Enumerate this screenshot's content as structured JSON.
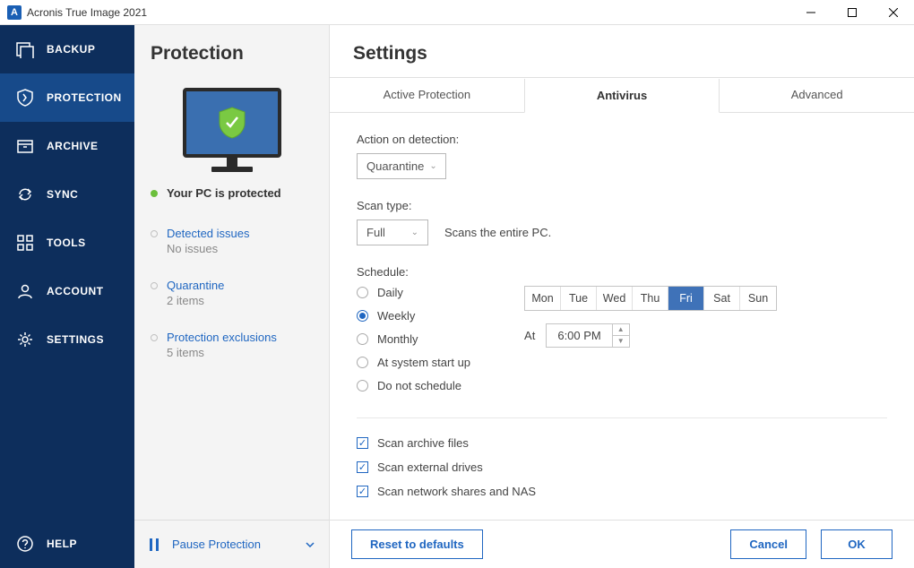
{
  "app_title": "Acronis True Image 2021",
  "sidebar": {
    "items": [
      {
        "label": "BACKUP"
      },
      {
        "label": "PROTECTION"
      },
      {
        "label": "ARCHIVE"
      },
      {
        "label": "SYNC"
      },
      {
        "label": "TOOLS"
      },
      {
        "label": "ACCOUNT"
      },
      {
        "label": "SETTINGS"
      }
    ],
    "help": "HELP"
  },
  "protection": {
    "title": "Protection",
    "status": "Your PC is protected",
    "blocks": [
      {
        "title": "Detected issues",
        "sub": "No issues"
      },
      {
        "title": "Quarantine",
        "sub": "2 items"
      },
      {
        "title": "Protection exclusions",
        "sub": "5 items"
      }
    ],
    "pause_label": "Pause Protection"
  },
  "settings": {
    "title": "Settings",
    "tabs": [
      "Active Protection",
      "Antivirus",
      "Advanced"
    ],
    "action_on_detection": {
      "label": "Action on detection:",
      "value": "Quarantine"
    },
    "scan_type": {
      "label": "Scan type:",
      "value": "Full",
      "desc": "Scans the entire PC."
    },
    "schedule": {
      "label": "Schedule:",
      "options": [
        "Daily",
        "Weekly",
        "Monthly",
        "At system start up",
        "Do not schedule"
      ],
      "selected": "Weekly",
      "days": [
        "Mon",
        "Tue",
        "Wed",
        "Thu",
        "Fri",
        "Sat",
        "Sun"
      ],
      "selected_day": "Fri",
      "at_label": "At",
      "time": "6:00 PM"
    },
    "checks": [
      "Scan archive files",
      "Scan external drives",
      "Scan network shares and NAS"
    ],
    "buttons": {
      "reset": "Reset to defaults",
      "cancel": "Cancel",
      "ok": "OK"
    }
  }
}
